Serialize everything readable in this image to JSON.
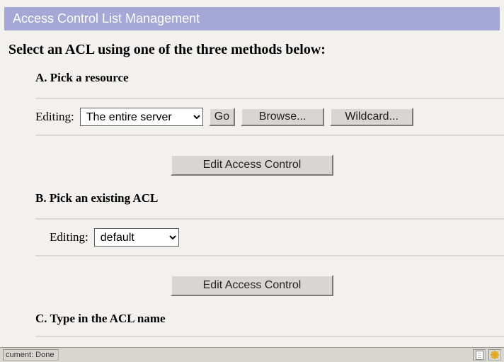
{
  "header": {
    "title": "Access Control List Management"
  },
  "subtitle": "Select an ACL using one of the three methods below:",
  "sectionA": {
    "heading": "A. Pick a resource",
    "editing_label": "Editing:",
    "resource_select": "The entire server",
    "go": "Go",
    "browse": "Browse...",
    "wildcard": "Wildcard...",
    "edit_btn": "Edit Access Control"
  },
  "sectionB": {
    "heading": "B. Pick an existing ACL",
    "editing_label": "Editing:",
    "acl_select": "default",
    "edit_btn": "Edit Access Control"
  },
  "sectionC": {
    "heading": "C. Type in the ACL name"
  },
  "status": {
    "text": "cument: Done"
  }
}
